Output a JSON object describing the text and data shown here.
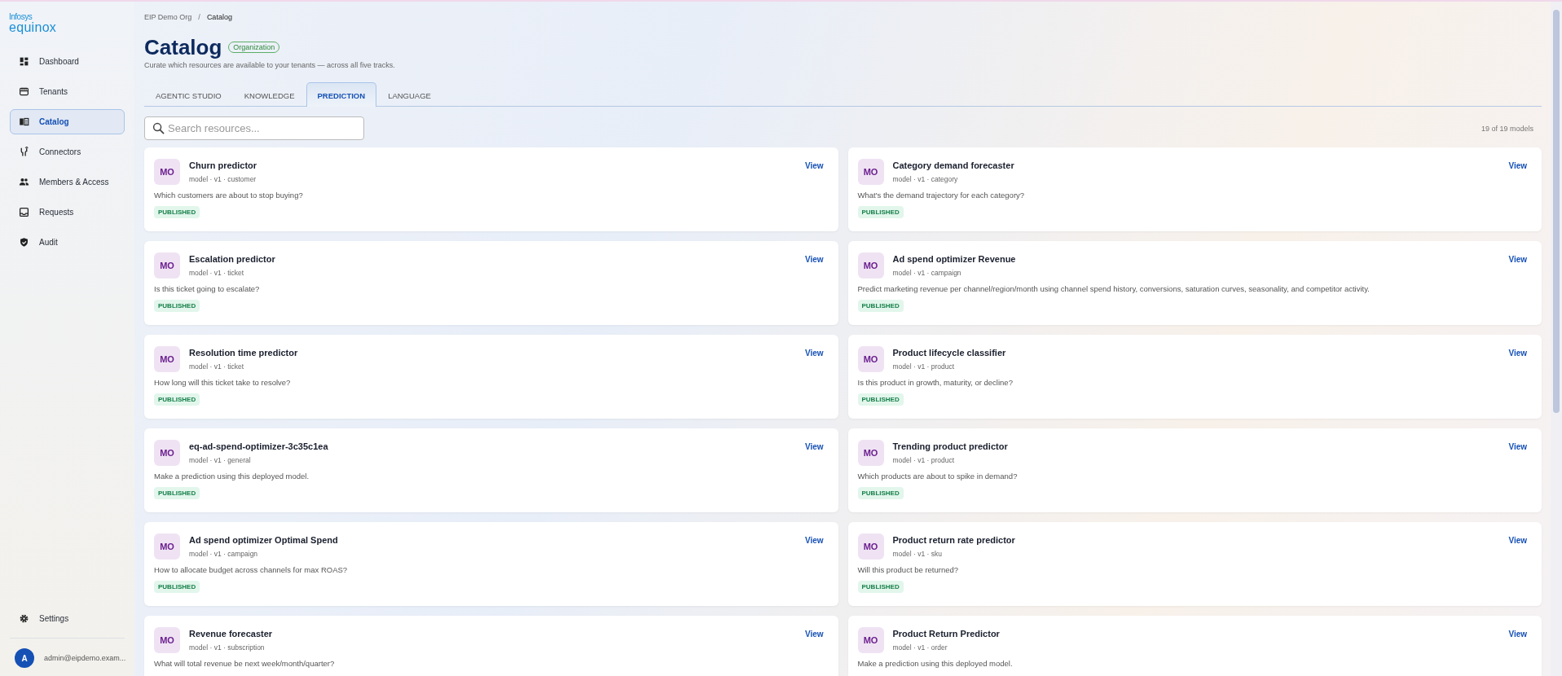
{
  "logo": {
    "brand": "Infosys",
    "product": "equinox"
  },
  "sidebar": {
    "items": [
      {
        "label": "Dashboard",
        "selected": false
      },
      {
        "label": "Tenants",
        "selected": false
      },
      {
        "label": "Catalog",
        "selected": true
      },
      {
        "label": "Connectors",
        "selected": false
      },
      {
        "label": "Members & Access",
        "selected": false
      },
      {
        "label": "Requests",
        "selected": false
      },
      {
        "label": "Audit",
        "selected": false
      }
    ],
    "settings": {
      "label": "Settings"
    },
    "user": {
      "initial": "A",
      "email": "admin@eipdemo.exam..."
    }
  },
  "breadcrumb": [
    "EIP Demo Org",
    "Catalog"
  ],
  "breadcrumb_separator": "/",
  "page": {
    "title": "Catalog",
    "badge": "Organization",
    "subtitle": "Curate which resources are available to your tenants — across all five tracks."
  },
  "tabs": [
    {
      "label": "AGENTIC STUDIO",
      "selected": false
    },
    {
      "label": "KNOWLEDGE",
      "selected": false
    },
    {
      "label": "PREDICTION",
      "selected": true
    },
    {
      "label": "LANGUAGE",
      "selected": false
    }
  ],
  "search": {
    "placeholder": "Search resources..."
  },
  "count": "19 of 19 models",
  "cards": [
    {
      "avatar": "MO",
      "name": "Churn predictor",
      "meta": "model · v1 · customer",
      "description": "Which customers are about to stop buying?",
      "status": "PUBLISHED",
      "action": "View"
    },
    {
      "avatar": "MO",
      "name": "Category demand forecaster",
      "meta": "model · v1 · category",
      "description": "What's the demand trajectory for each category?",
      "status": "PUBLISHED",
      "action": "View"
    },
    {
      "avatar": "MO",
      "name": "Escalation predictor",
      "meta": "model · v1 · ticket",
      "description": "Is this ticket going to escalate?",
      "status": "PUBLISHED",
      "action": "View"
    },
    {
      "avatar": "MO",
      "name": "Ad spend optimizer Revenue",
      "meta": "model · v1 · campaign",
      "description": "Predict marketing revenue per channel/region/month using channel spend history, conversions, saturation curves, seasonality, and competitor activity.",
      "status": "PUBLISHED",
      "action": "View"
    },
    {
      "avatar": "MO",
      "name": "Resolution time predictor",
      "meta": "model · v1 · ticket",
      "description": "How long will this ticket take to resolve?",
      "status": "PUBLISHED",
      "action": "View"
    },
    {
      "avatar": "MO",
      "name": "Product lifecycle classifier",
      "meta": "model · v1 · product",
      "description": "Is this product in growth, maturity, or decline?",
      "status": "PUBLISHED",
      "action": "View"
    },
    {
      "avatar": "MO",
      "name": "eq-ad-spend-optimizer-3c35c1ea",
      "meta": "model · v1 · general",
      "description": "Make a prediction using this deployed model.",
      "status": "PUBLISHED",
      "action": "View"
    },
    {
      "avatar": "MO",
      "name": "Trending product predictor",
      "meta": "model · v1 · product",
      "description": "Which products are about to spike in demand?",
      "status": "PUBLISHED",
      "action": "View"
    },
    {
      "avatar": "MO",
      "name": "Ad spend optimizer Optimal Spend",
      "meta": "model · v1 · campaign",
      "description": "How to allocate budget across channels for max ROAS?",
      "status": "PUBLISHED",
      "action": "View"
    },
    {
      "avatar": "MO",
      "name": "Product return rate predictor",
      "meta": "model · v1 · sku",
      "description": "Will this product be returned?",
      "status": "PUBLISHED",
      "action": "View"
    },
    {
      "avatar": "MO",
      "name": "Revenue forecaster",
      "meta": "model · v1 · subscription",
      "description": "What will total revenue be next week/month/quarter?",
      "action": "View"
    },
    {
      "avatar": "MO",
      "name": "Product Return Predictor",
      "meta": "model · v1 · order",
      "description": "Make a prediction using this deployed model.",
      "action": "View"
    }
  ]
}
